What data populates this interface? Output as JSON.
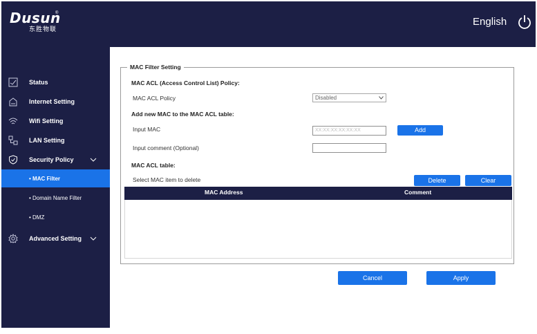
{
  "header": {
    "logo_text": "Dusun",
    "logo_reg": "®",
    "logo_sub": "东胜物联",
    "language": "English"
  },
  "sidebar": {
    "items": [
      {
        "label": "Status",
        "icon": "status-chart-icon"
      },
      {
        "label": "Internet Setting",
        "icon": "internet-icon"
      },
      {
        "label": "Wifi Setting",
        "icon": "wifi-icon"
      },
      {
        "label": "LAN Setting",
        "icon": "lan-icon"
      },
      {
        "label": "Security Policy",
        "icon": "shield-icon"
      },
      {
        "label": "Advanced Setting",
        "icon": "gear-icon"
      }
    ],
    "sub_items": [
      {
        "label": "• MAC Filter",
        "active": true
      },
      {
        "label": "• Domain Name Filter",
        "active": false
      },
      {
        "label": "• DMZ",
        "active": false
      }
    ]
  },
  "main": {
    "legend": "MAC Filter Setting",
    "policy_title": "MAC ACL (Access Control List) Policy:",
    "policy_label": "MAC ACL Policy",
    "policy_value": "Disabled",
    "add_title": "Add new MAC to the MAC ACL table:",
    "input_mac_label": "Input MAC",
    "input_mac_placeholder": "XX:XX:XX:XX:XX:XX",
    "add_button": "Add",
    "comment_label": "Input comment (Optional)",
    "comment_value": "",
    "table_title": "MAC ACL table:",
    "select_hint": "Select MAC item to delete",
    "delete_button": "Delete",
    "clear_button": "Clear",
    "table_columns": [
      "MAC Address",
      "Comment"
    ],
    "table_rows": []
  },
  "actions": {
    "cancel": "Cancel",
    "apply": "Apply"
  },
  "colors": {
    "navy": "#1c1f45",
    "accent": "#1a73e8"
  }
}
